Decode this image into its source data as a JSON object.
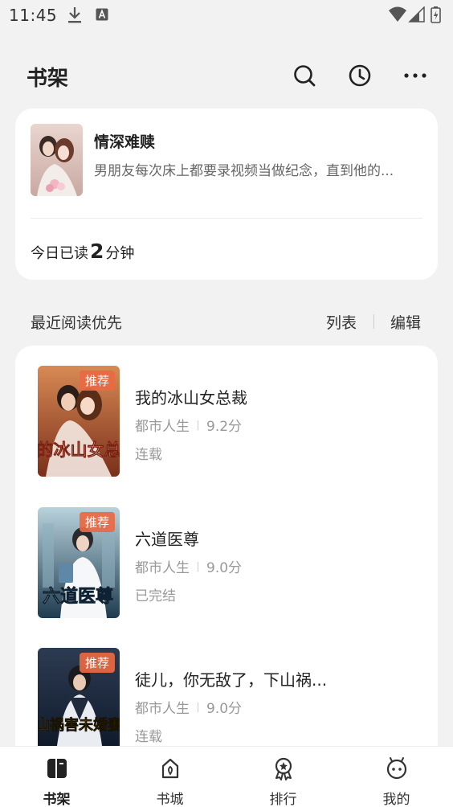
{
  "status_bar": {
    "time": "11:45"
  },
  "header": {
    "title": "书架"
  },
  "current_book": {
    "title": "情深难赎",
    "description": "男朋友每次床上都要录视频当做纪念，直到他的...",
    "read_prefix": "今日已读",
    "read_minutes": "2",
    "read_suffix": "分钟"
  },
  "section": {
    "sort_label": "最近阅读优先",
    "list_label": "列表",
    "edit_label": "编辑"
  },
  "books": [
    {
      "title": "我的冰山女总裁",
      "badge": "推荐",
      "category": "都市人生",
      "score": "9.2分",
      "status": "连载",
      "cover_text": "我的冰山女总裁"
    },
    {
      "title": "六道医尊",
      "badge": "推荐",
      "category": "都市人生",
      "score": "9.0分",
      "status": "已完结",
      "cover_text": "六道医尊"
    },
    {
      "title": "徒儿，你无敌了，下山祸...",
      "badge": "推荐",
      "category": "都市人生",
      "score": "9.0分",
      "status": "连载",
      "cover_text": "下山祸害未婚妻吧"
    }
  ],
  "tabs": [
    {
      "label": "书架",
      "icon": "bookshelf-icon",
      "active": true
    },
    {
      "label": "书城",
      "icon": "bookstore-icon",
      "active": false
    },
    {
      "label": "排行",
      "icon": "ranking-icon",
      "active": false
    },
    {
      "label": "我的",
      "icon": "profile-icon",
      "active": false
    }
  ],
  "colors": {
    "badge": "#e96942",
    "background": "#f2f2f2",
    "card": "#ffffff"
  }
}
